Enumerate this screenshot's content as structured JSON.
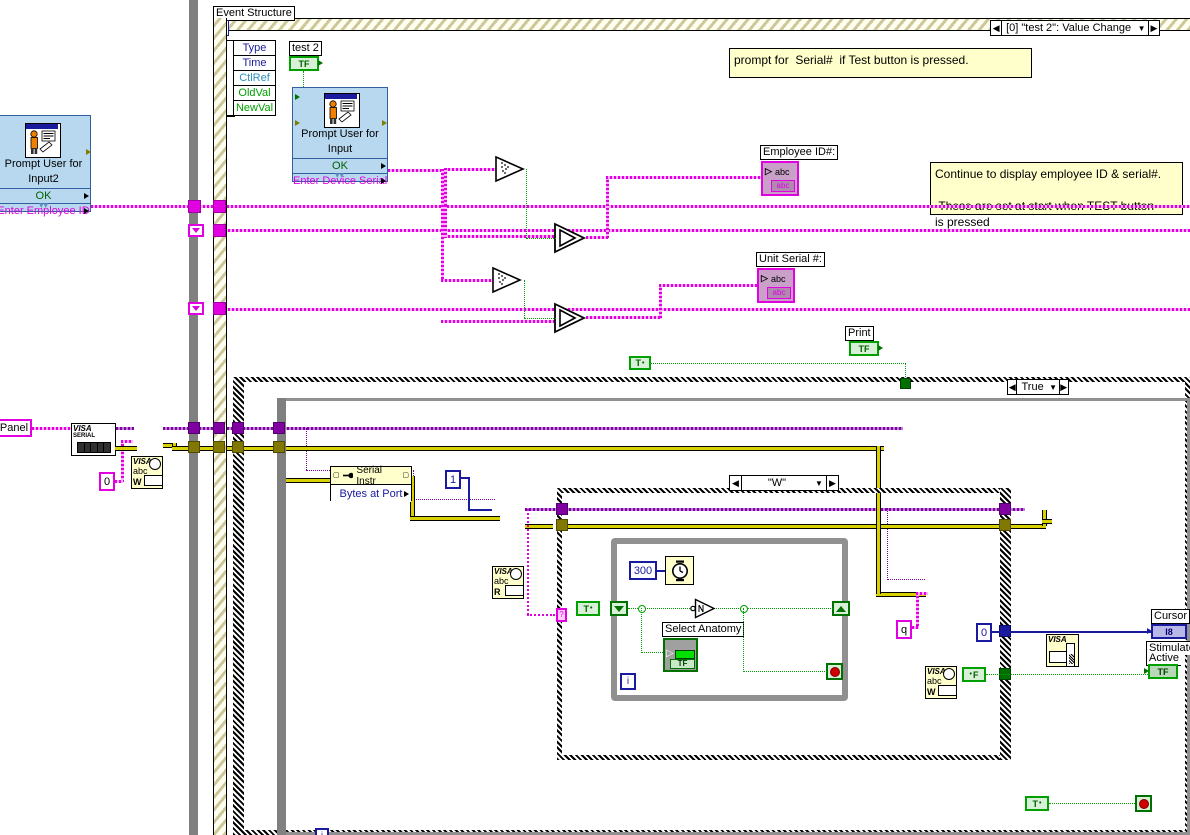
{
  "diagram": {
    "title": "Event Structure",
    "event_case_label": "[0] \"test 2\": Value Change",
    "comments": [
      "prompt for  Serial#  if Test button is pressed.",
      "Continue to display employee ID & serial#.\n\n These are set at start when TEST button\nis pressed"
    ]
  },
  "event_structure": {
    "label": "Event Structure",
    "terminals": [
      "Type",
      "Time",
      "CtlRef",
      "OldVal",
      "NewVal"
    ],
    "selector": "[0] \"test 2\": Value Change"
  },
  "subvis": {
    "prompt_input2": {
      "title": "Prompt User for\nInput2",
      "title_line1": "Prompt User for",
      "title_line2": "Input2",
      "ok_label": "OK",
      "out_label": "Enter Employee ID"
    },
    "prompt_input": {
      "title_line1": "Prompt User for",
      "title_line2": "Input",
      "ok_label": "OK",
      "out_label": "Enter Device Serial"
    }
  },
  "controls": {
    "test2": "test 2",
    "test2_type": "TF",
    "print": "Print",
    "print_type": "TF",
    "panel": "Panel",
    "select_anatomy": "Select Anatomy",
    "select_anatomy_type": "TF"
  },
  "indicators": {
    "employee_id": "Employee ID#:",
    "employee_id_type": "abc",
    "unit_serial": "Unit Serial #:",
    "unit_serial_type": "abc",
    "cursor": "Cursor",
    "cursor_type": "I8",
    "stimulator_line1": "Stimulator",
    "stimulator_line2": "Active",
    "stimulator_type": "TF"
  },
  "constants": {
    "zero_str": "0",
    "one_int": "1",
    "three_hundred": "300",
    "q_str": "q",
    "zero_int": "0",
    "true_bool": "T",
    "false_bool": "F"
  },
  "case_structures": {
    "outer_true": "True",
    "inner_w": "\"W\""
  },
  "property_node": {
    "ref_label": "Serial Instr",
    "property": "Bytes at Port"
  },
  "visa_nodes": {
    "visa_serial_label": "VISA",
    "visa_serial_sub": "SERIAL",
    "visa_write_label": "VISA",
    "visa_write_sub": "abc",
    "visa_write_mode": "W",
    "visa_read_label": "VISA",
    "visa_read_sub": "abc",
    "visa_read_mode": "R",
    "visa_close_label": "VISA"
  },
  "icons": {
    "hourglass": "hourglass-icon",
    "clock": "wait-ms-icon",
    "person_form": "prompt-user-icon",
    "stop": "stop-button-icon",
    "not": "not-gate-icon",
    "empty_string": "empty-string-path-icon",
    "select": "select-function-icon"
  },
  "colors": {
    "string_wire": "#e000e0",
    "visa_wire": "#8000a0",
    "error_wire": "#d8d000",
    "boolean_wire": "#00a000",
    "integer_wire": "#1a1a9e",
    "comment_bg": "#ffffcc",
    "subvi_bg": "#b8d8f0",
    "structure_gray": "#909090"
  }
}
